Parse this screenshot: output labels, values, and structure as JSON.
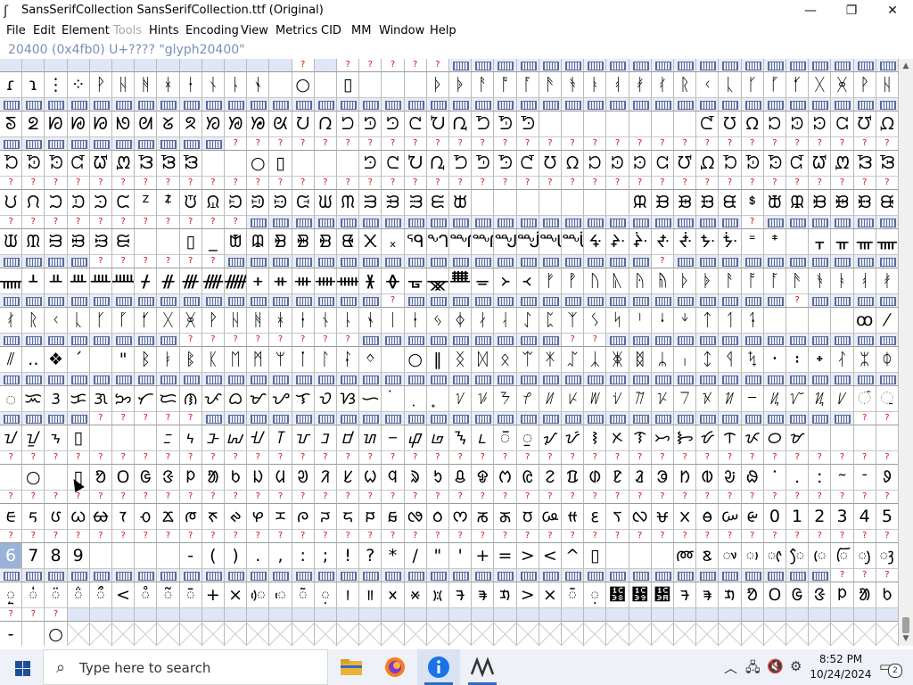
{
  "window": {
    "title": "SansSerifCollection  SansSerifCollection.ttf (Original)",
    "minimize_icon": "minimize-icon",
    "maximize_icon": "maximize-icon",
    "close_icon": "close-icon"
  },
  "menu": {
    "items": [
      {
        "label": "File",
        "enabled": true
      },
      {
        "label": "Edit",
        "enabled": true
      },
      {
        "label": "Element",
        "enabled": true
      },
      {
        "label": "Tools",
        "enabled": false
      },
      {
        "label": "Hints",
        "enabled": true
      },
      {
        "label": "Encoding",
        "enabled": true
      },
      {
        "label": "View",
        "enabled": true
      },
      {
        "label": "Metrics",
        "enabled": true
      },
      {
        "label": "CID",
        "enabled": true
      },
      {
        "label": "MM",
        "enabled": true
      },
      {
        "label": "Window",
        "enabled": true
      },
      {
        "label": "Help",
        "enabled": true
      }
    ]
  },
  "status": {
    "glyph_info": "20400 (0x4fb0) U+???? \"glyph20400\""
  },
  "font_view": {
    "columns": 40,
    "label_q": "?",
    "rows": [
      {
        "labels": "eeeeeeeeeeeeeqeqqqqqbbbbbbbbbbbbbbbbbbbbb",
        "glyphs": [
          "ɾ",
          "ɿ",
          "⋮",
          "⁘",
          "ᚹ",
          "ᚺ",
          "ᚻ",
          "ᚼ",
          "ᚽ",
          "ᚾ",
          "ᚿ",
          "ᛀ",
          "",
          "○",
          "",
          "▯",
          "",
          "",
          "",
          "ᚦ",
          "ᚧ",
          "ᚨ",
          "ᚩ",
          "ᚪ",
          "ᚫ",
          "ᚬ",
          "ᚭ",
          "ᚮ",
          "ᚯ",
          "ᚰ",
          "ᚱ",
          "ᚲ",
          "ᚳ",
          "ᚴ",
          "ᚵ",
          "ᚶ",
          "ᚷ",
          "ᚸ",
          "ᚹ",
          "ᚺ"
        ]
      },
      {
        "labels": "bbbbbbbbbbbbbbbbbbbbbbbbbbbbbbbbbbbbbbbb",
        "glyphs": [
          "ᘕ",
          "ᘖ",
          "ᘗ",
          "ᘘ",
          "ᘙ",
          "ᘚ",
          "ᘛ",
          "ᘜ",
          "ᘝ",
          "ᘞ",
          "ᘟ",
          "ᘠ",
          "ᘡ",
          "ᘢ",
          "ᘣ",
          "ᘤ",
          "ᘥ",
          "ᘦ",
          "ᘧ",
          "ᘨ",
          "ᘩ",
          "ᘪ",
          "ᘫ",
          "ᘬ",
          "",
          "",
          "",
          "",
          "",
          "",
          "",
          "ᘭ",
          "ᘮ",
          "ᘯ",
          "ᘰ",
          "ᘱ",
          "ᘲ",
          "ᘳ",
          "ᘴ",
          "ᘵ"
        ]
      },
      {
        "labels": "bbbbbbbbbbqqqqqqqqqqqqqqqqqqqqqqqqqqqqqq",
        "glyphs": [
          "ᘶ",
          "ᘷ",
          "ᘸ",
          "ᘹ",
          "ᘺ",
          "ᘻ",
          "ᘼ",
          "ᘽ",
          "ᘾ",
          "",
          "",
          "○",
          "▯",
          "",
          "",
          "",
          "ᘦ",
          "ᘧ",
          "ᘨ",
          "ᘩ",
          "ᘪ",
          "ᘫ",
          "ᘬ",
          "ᘭ",
          "ᘮ",
          "ᘯ",
          "ᘰ",
          "ᘱ",
          "ᘲ",
          "ᘳ",
          "ᘴ",
          "ᘵ",
          "ᘶ",
          "ᘷ",
          "ᘸ",
          "ᘹ",
          "ᘺ",
          "ᘻ",
          "ᘼ",
          "ᘽ"
        ]
      },
      {
        "labels": "qqqqqqqqqqqqqqqqqqqqqqqqqqqqqqqqqqqqqqqq",
        "glyphs": [
          "ᙀ",
          "ᙁ",
          "ᙂ",
          "ᙃ",
          "ᙄ",
          "ᙅ",
          "ᙆ",
          "ᙇ",
          "ᙈ",
          "ᙉ",
          "ᙊ",
          "ᙋ",
          "ᙌ",
          "ᙍ",
          "ᙎ",
          "ᙏ",
          "ᙐ",
          "ᙑ",
          "ᙒ",
          "ᙓ",
          "ᙔ",
          "",
          "",
          "",
          "",
          "",
          "",
          "",
          "ᙕ",
          "ᙖ",
          "ᙗ",
          "ᙘ",
          "ᙙ",
          "ᙚ",
          "ᙛ",
          "ᙜ",
          "ᙝ",
          "ᙞ",
          "ᙟ",
          "ᙠ"
        ]
      },
      {
        "labels": "qqqqqqqqqqqbbbbbbbbbbbbbbbbbbbbbbqbbbbbb",
        "glyphs": [
          "ᙡ",
          "ᙢ",
          "ᙣ",
          "ᙤ",
          "ᙥ",
          "ᙦ",
          "",
          "",
          "▯",
          "_",
          "ᙧ",
          "ᙨ",
          "ᙩ",
          "ᙪ",
          "ᙫ",
          "ᙬ",
          "᙭",
          "᙮",
          "ᙯ",
          "ᙰ",
          "ᙱ",
          "ᙲ",
          "ᙳ",
          "ᙴ",
          "ᙵ",
          "ᙶ",
          "ᙷ",
          "ᙸ",
          "ᙹ",
          "ᙺ",
          "ᙻ",
          "ᙼ",
          "ᙽ",
          "ᙾ",
          "ᙿ",
          "",
          "ᚁ",
          "ᚂ",
          "ᚃ",
          "ᚄ"
        ]
      },
      {
        "labels": "bbbbqqqqqqbbbbbbbbbbbbbbbbbbbqbbbbbbbbbb",
        "glyphs": [
          "ᚅ",
          "ᚆ",
          "ᚇ",
          "ᚈ",
          "ᚉ",
          "ᚊ",
          "ᚋ",
          "ᚌ",
          "ᚍ",
          "ᚎ",
          "ᚏ",
          "ᚐ",
          "ᚑ",
          "ᚒ",
          "ᚓ",
          "ᚔ",
          "ᚕ",
          "ᚖ",
          "ᚗ",
          "ᚘ",
          "ᚙ",
          "ᚚ",
          "᚛",
          "᚜",
          "ᚠ",
          "ᚡ",
          "ᚢ",
          "ᚣ",
          "ᚤ",
          "ᚥ",
          "ᚦ",
          "ᚧ",
          "ᚨ",
          "ᚩ",
          "ᚪ",
          "ᚫ",
          "ᚬ",
          "ᚭ",
          "ᚮ",
          "ᚯ"
        ]
      },
      {
        "labels": "bbbbbbbbbbbbbbbbbqbbbbbbbbbbbbbbbbbqbbbb",
        "glyphs": [
          "ᚰ",
          "ᚱ",
          "ᚲ",
          "ᚳ",
          "ᚴ",
          "ᚵ",
          "ᚶ",
          "ᚷ",
          "ᚸ",
          "ᚹ",
          "ᚺ",
          "ᚻ",
          "ᚼ",
          "ᚽ",
          "ᚾ",
          "ᚿ",
          "ᛀ",
          "ᛁ",
          "ᛂ",
          "ᛃ",
          "ᛄ",
          "ᛅ",
          "ᛆ",
          "ᛇ",
          "ᛈ",
          "ᛉ",
          "ᛊ",
          "ᛋ",
          "ᛌ",
          "ᛍ",
          "ᛎ",
          "ᛏ",
          "ᛐ",
          "ᛑ",
          "",
          "",
          "",
          "",
          "ꝏ",
          "⁄"
        ]
      },
      {
        "labels": "bbbbbbbbqqqqqqqqbbbbbbbbbqqbbbbbbbbbbbbb",
        "glyphs": [
          "⫽",
          "‥",
          "❖",
          "´",
          "",
          "\"",
          "ᛒ",
          "ᛓ",
          "ᛔ",
          "ᛕ",
          "ᛖ",
          "ᛗ",
          "ᛘ",
          "ᛙ",
          "ᛚ",
          "ᛛ",
          "ᛜ",
          "",
          "○",
          "‖",
          "ᛝ",
          "ᛞ",
          "ᛟ",
          "ᛠ",
          "ᛡ",
          "ᛢ",
          "ᛣ",
          "ᛤ",
          "ᛥ",
          "ᛦ",
          "ᛧ",
          "ᛨ",
          "ᛩ",
          "ᛪ",
          "᛫",
          "᛬",
          "᛭",
          "ᛮ",
          "ᛯ",
          "ᛰ"
        ]
      },
      {
        "labels": "bbbbbbbbbbbbbbbbbbbbbbbbbbbbbbbbbbbbbbbb",
        "glyphs": [
          "ᜀ",
          "ᜁ",
          "ᜂ",
          "ᜃ",
          "ᜄ",
          "ᜅ",
          "ᜆ",
          "ᜇ",
          "ᜈ",
          "ᜉ",
          "ᜊ",
          "ᜋ",
          "ᜌ",
          "ᜎ",
          "ᜏ",
          "ᜐ",
          "ᜑ",
          "ᜒ",
          "ᜓ",
          "᜔",
          "ᜠ",
          "ᜡ",
          "ᜢ",
          "ᜣ",
          "ᜤ",
          "ᜥ",
          "ᜦ",
          "ᜧ",
          "ᜨ",
          "ᜩ",
          "ᜪ",
          "ᜫ",
          "ᜬ",
          "ᜭ",
          "ᜮ",
          "ᜯ",
          "ᜰ",
          "ᜱ",
          "ᜲ",
          "ᜳ"
        ]
      },
      {
        "labels": "bbbbqqqqqbbbbbbbbbbbbbbbbbbbbbbbbbbbbbqq",
        "glyphs": [
          "ᝀ",
          "ᝁ",
          "ᝂ",
          "▯",
          "",
          "",
          "",
          "ᝃ",
          "ᝄ",
          "ᝅ",
          "ᝆ",
          "ᝇ",
          "ᝈ",
          "ᝉ",
          "ᝊ",
          "ᝋ",
          "ᝌ",
          "ᝍ",
          "ᝎ",
          "ᝏ",
          "ᝐ",
          "ᝑ",
          "ᝒ",
          "ᝓ",
          "ᝠ",
          "ᝡ",
          "ᝢ",
          "ᝣ",
          "ᝤ",
          "ᝥ",
          "ᝦ",
          "ᝧ",
          "ᝨ",
          "ᝩ",
          "ᝪ",
          "ᝫ",
          "",
          "",
          "",
          ""
        ]
      },
      {
        "labels": "qqqqqqqqqqqqqqqqqqqqqqqqqqqqqqqqqqqqqqqq",
        "glyphs": [
          "",
          "○",
          "",
          "▯",
          "ᱚ",
          "ᱛ",
          "ᱜ",
          "ᱝ",
          "ᱞ",
          "ᱟ",
          "ᱠ",
          "ᱡ",
          "ᱢ",
          "ᱣ",
          "ᱤ",
          "ᱥ",
          "ᱦ",
          "ᱧ",
          "ᱨ",
          "ᱩ",
          "ᱪ",
          "ᱫ",
          "ᱬ",
          "ᱭ",
          "ᱮ",
          "ᱯ",
          "ᱰ",
          "ᱱ",
          "ᱲ",
          "ᱳ",
          "ᱴ",
          "ᱵ",
          "ᱶ",
          "ᱷ",
          "ᱸ",
          "ᱹ",
          "ᱺ",
          "ᱻ",
          "ᱼ",
          "ᱽ"
        ]
      },
      {
        "labels": "qqqqqqqqqqqqqqqqqqqqqqqqqqqqqqqqqqqqqqqq",
        "glyphs": [
          "ᰀ",
          "ᰁ",
          "ᰂ",
          "ᰃ",
          "ᰄ",
          "ᰅ",
          "ᰆ",
          "ᰇ",
          "ᰈ",
          "ᰉ",
          "ᰊ",
          "ᰋ",
          "ᰌ",
          "ᰍ",
          "ᰎ",
          "ᰏ",
          "ᰐ",
          "ᰑ",
          "ᰒ",
          "ᰓ",
          "ᰔ",
          "ᰕ",
          "ᰖ",
          "ᰗ",
          "ᰘ",
          "ᰙ",
          "ᰚ",
          "ᰛ",
          "ᰜ",
          "ᰝ",
          "ᰞ",
          "ᰟ",
          "ᰠ",
          "ᰡ",
          "0",
          "1",
          "2",
          "3",
          "4",
          "5"
        ]
      },
      {
        "labels": "qqqqqqqqqqqqqqqqqqqqqqqqqqqqqqqqqqqqqqqq",
        "glyphs": [
          "6",
          "7",
          "8",
          "9",
          "",
          "",
          "",
          "",
          "-",
          "(",
          ")",
          ".",
          ",",
          ":",
          ";",
          "!",
          "?",
          "*",
          "/",
          "\"",
          "'",
          "+",
          "=",
          ">",
          "<",
          "^",
          "▯",
          "",
          "",
          "",
          "ᰢ",
          "ᰣ",
          "ᰤ",
          "ᰥ",
          "ᰦ",
          "ᰧ",
          "ᰨ",
          "ᰩ",
          "ᰪ",
          "ᰫ"
        ]
      },
      {
        "labels": "bbbbbbbbbbbbbbbbbbbbbbbbbbbbbbbbbbbbbqqq",
        "glyphs": [
          "ᰬ",
          "ᰭ",
          "ᰮ",
          "ᰯ",
          "ᰰ",
          "<",
          "ᰱ",
          "ᰲ",
          "ᰳ",
          "+",
          "×",
          "ᰴ",
          "ᰵ",
          "ᰶ",
          "᰷",
          "᰻",
          "᰼",
          "᰽",
          "᰾",
          "᰿",
          "ᱍ",
          "ᱎ",
          "ᱏ",
          ">",
          "×",
          "ᰶ",
          "᰷",
          "᰸",
          "᰹",
          "᰺",
          "ᱍ",
          "ᱎ",
          "ᱏ",
          "ᱚ",
          "ᱛ",
          "ᱜ",
          "ᱝ",
          "ᱞ",
          "ᱟ",
          "ᱠ"
        ]
      },
      {
        "labels": "qqqeeeeeeeeeeeeeeeeeeeeeeeeeeeeeeeeeeeee",
        "glyphs": [
          "-",
          "",
          "○",
          "x",
          "x",
          "x",
          "x",
          "x",
          "x",
          "x",
          "x",
          "x",
          "x",
          "x",
          "x",
          "x",
          "x",
          "x",
          "x",
          "x",
          "x",
          "x",
          "x",
          "x",
          "x",
          "x",
          "x",
          "x",
          "x",
          "x",
          "x",
          "x",
          "x",
          "x",
          "x",
          "x",
          "x",
          "x",
          "x",
          "x"
        ]
      }
    ],
    "selected_cell": "6"
  },
  "taskbar": {
    "search_placeholder": "Type here to search",
    "search_icon": "search-icon",
    "apps": [
      {
        "name": "file-explorer",
        "icon": "folder-icon"
      },
      {
        "name": "firefox",
        "icon": "firefox-icon"
      },
      {
        "name": "info-app",
        "icon": "info-icon",
        "active": true
      },
      {
        "name": "fontforge",
        "icon": "fontforge-icon"
      }
    ],
    "tray": {
      "time": "8:52 PM",
      "date": "10/24/2024",
      "notification_count": "2"
    }
  },
  "colors": {
    "accent": "#2b6cc4",
    "unmapped_label": "#d01010",
    "bitmap_label_bg": "#e9edf7",
    "selected_cell": "#9bb3d8",
    "infoline_text": "#7a8fb8"
  }
}
